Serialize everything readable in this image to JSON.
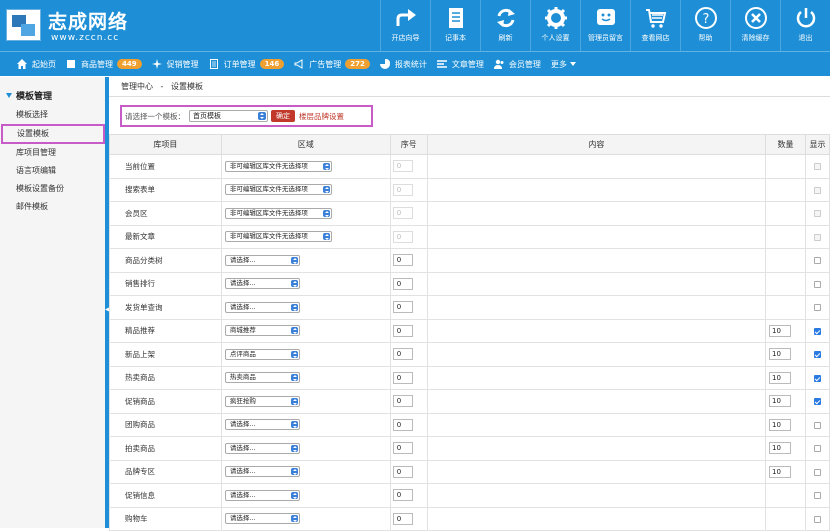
{
  "brand": {
    "name": "志成网络",
    "url": "www.zccn.cc"
  },
  "top_nav": [
    {
      "label": "开店向导",
      "icon": "share-arrow-icon"
    },
    {
      "label": "记事本",
      "icon": "notepad-icon"
    },
    {
      "label": "刷新",
      "icon": "refresh-icon"
    },
    {
      "label": "个人设置",
      "icon": "gear-icon"
    },
    {
      "label": "管理员留言",
      "icon": "smiley-message-icon"
    },
    {
      "label": "查看网店",
      "icon": "cart-icon"
    },
    {
      "label": "帮助",
      "icon": "help-icon"
    },
    {
      "label": "清除缓存",
      "icon": "clear-icon"
    },
    {
      "label": "退出",
      "icon": "power-icon"
    }
  ],
  "main_nav": [
    {
      "label": "起始页",
      "icon": "home-icon",
      "badge": ""
    },
    {
      "label": "商品管理",
      "icon": "goods-icon",
      "badge": "449"
    },
    {
      "label": "促销管理",
      "icon": "promo-icon",
      "badge": ""
    },
    {
      "label": "订单管理",
      "icon": "order-icon",
      "badge": "146"
    },
    {
      "label": "广告管理",
      "icon": "ad-icon",
      "badge": "272"
    },
    {
      "label": "报表统计",
      "icon": "chart-icon",
      "badge": ""
    },
    {
      "label": "文章管理",
      "icon": "article-icon",
      "badge": ""
    },
    {
      "label": "会员管理",
      "icon": "member-icon",
      "badge": ""
    }
  ],
  "more_label": "更多",
  "sidebar": {
    "title": "模板管理",
    "items": [
      "模板选择",
      "设置模板",
      "库项目管理",
      "语言项编辑",
      "模板设置备份",
      "邮件模板"
    ]
  },
  "breadcrumb": {
    "root": "管理中心",
    "sep": "-",
    "current": "设置模板"
  },
  "template_select": {
    "label": "请选择一个模板：",
    "value": "首页模板",
    "confirm": "确定",
    "link": "楼层品牌设置"
  },
  "table": {
    "headers": [
      "库项目",
      "区域",
      "序号",
      "内容",
      "数量",
      "显示"
    ],
    "rows": [
      {
        "name": "当前位置",
        "region": "非可编辑区库文件无选择项",
        "seq": "0",
        "seq_disabled": true,
        "qty": "",
        "checked": false,
        "cb_disabled": true
      },
      {
        "name": "搜索表单",
        "region": "非可编辑区库文件无选择项",
        "seq": "0",
        "seq_disabled": true,
        "qty": "",
        "checked": false,
        "cb_disabled": true
      },
      {
        "name": "会员区",
        "region": "非可编辑区库文件无选择项",
        "seq": "0",
        "seq_disabled": true,
        "qty": "",
        "checked": false,
        "cb_disabled": true
      },
      {
        "name": "最新文章",
        "region": "非可编辑区库文件无选择项",
        "seq": "0",
        "seq_disabled": true,
        "qty": "",
        "checked": false,
        "cb_disabled": true
      },
      {
        "name": "商品分类树",
        "region": "请选择...",
        "seq": "0",
        "seq_disabled": false,
        "qty": "",
        "checked": false,
        "cb_disabled": false
      },
      {
        "name": "销售排行",
        "region": "请选择...",
        "seq": "0",
        "seq_disabled": false,
        "qty": "",
        "checked": false,
        "cb_disabled": false
      },
      {
        "name": "发货单查询",
        "region": "请选择...",
        "seq": "0",
        "seq_disabled": false,
        "qty": "",
        "checked": false,
        "cb_disabled": false
      },
      {
        "name": "精品推荐",
        "region": "商城推荐",
        "seq": "0",
        "seq_disabled": false,
        "qty": "10",
        "checked": true,
        "cb_disabled": false
      },
      {
        "name": "新品上架",
        "region": "点评商品",
        "seq": "0",
        "seq_disabled": false,
        "qty": "10",
        "checked": true,
        "cb_disabled": false
      },
      {
        "name": "热卖商品",
        "region": "热卖商品",
        "seq": "0",
        "seq_disabled": false,
        "qty": "10",
        "checked": true,
        "cb_disabled": false
      },
      {
        "name": "促销商品",
        "region": "疯狂抢购",
        "seq": "0",
        "seq_disabled": false,
        "qty": "10",
        "checked": true,
        "cb_disabled": false
      },
      {
        "name": "团购商品",
        "region": "请选择...",
        "seq": "0",
        "seq_disabled": false,
        "qty": "10",
        "checked": false,
        "cb_disabled": false
      },
      {
        "name": "拍卖商品",
        "region": "请选择...",
        "seq": "0",
        "seq_disabled": false,
        "qty": "10",
        "checked": false,
        "cb_disabled": false
      },
      {
        "name": "品牌专区",
        "region": "请选择...",
        "seq": "0",
        "seq_disabled": false,
        "qty": "10",
        "checked": false,
        "cb_disabled": false
      },
      {
        "name": "促销信息",
        "region": "请选择...",
        "seq": "0",
        "seq_disabled": false,
        "qty": "",
        "checked": false,
        "cb_disabled": false
      },
      {
        "name": "购物车",
        "region": "请选择...",
        "seq": "0",
        "seq_disabled": false,
        "qty": "",
        "checked": false,
        "cb_disabled": false
      }
    ]
  },
  "colors": {
    "header_blue": "#1e8fd6",
    "badge_orange": "#f0a030",
    "highlight_magenta": "#c75bc7",
    "confirm_red": "#c0392b",
    "check_blue": "#2a7ae2"
  }
}
